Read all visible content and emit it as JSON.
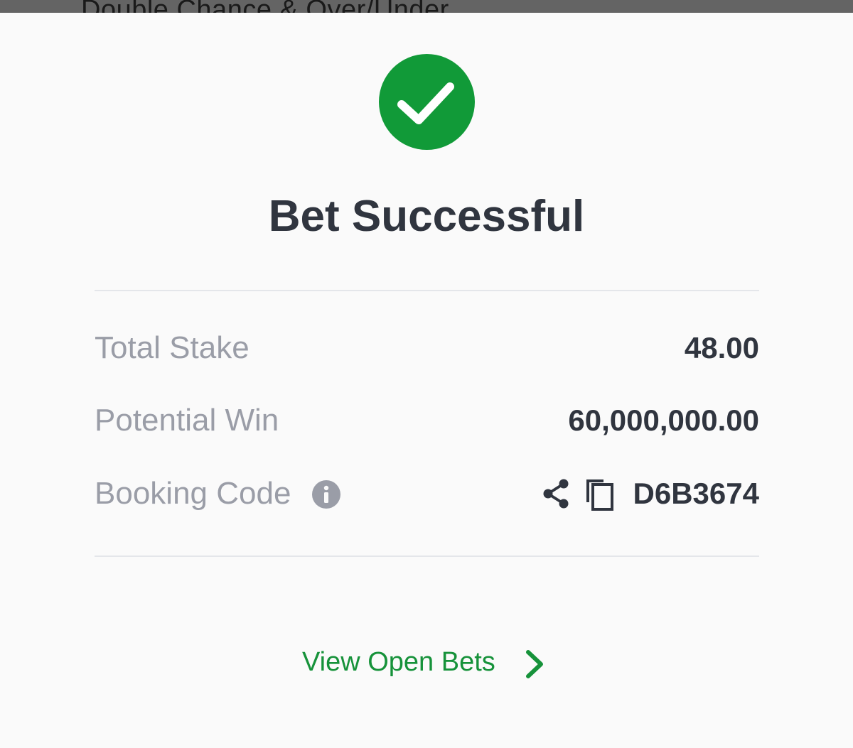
{
  "background_title": "Double Chance & Over/Under",
  "status": {
    "icon": "check-circle-icon",
    "title": "Bet Successful"
  },
  "details": {
    "total_stake_label": "Total Stake",
    "total_stake_value": "48.00",
    "potential_win_label": "Potential Win",
    "potential_win_value": "60,000,000.00",
    "booking_code_label": "Booking Code",
    "booking_code_value": "D6B3674",
    "info_icon": "info-icon",
    "share_icon": "share-icon",
    "copy_icon": "copy-icon"
  },
  "actions": {
    "view_open_bets_label": "View Open Bets",
    "chevron_icon": "chevron-right-icon"
  },
  "colors": {
    "success_green": "#119a38",
    "link_green": "#16923a",
    "text_dark": "#30353f",
    "text_muted": "#9a9da7",
    "divider": "#e4e6ea",
    "background": "#fafafa"
  }
}
